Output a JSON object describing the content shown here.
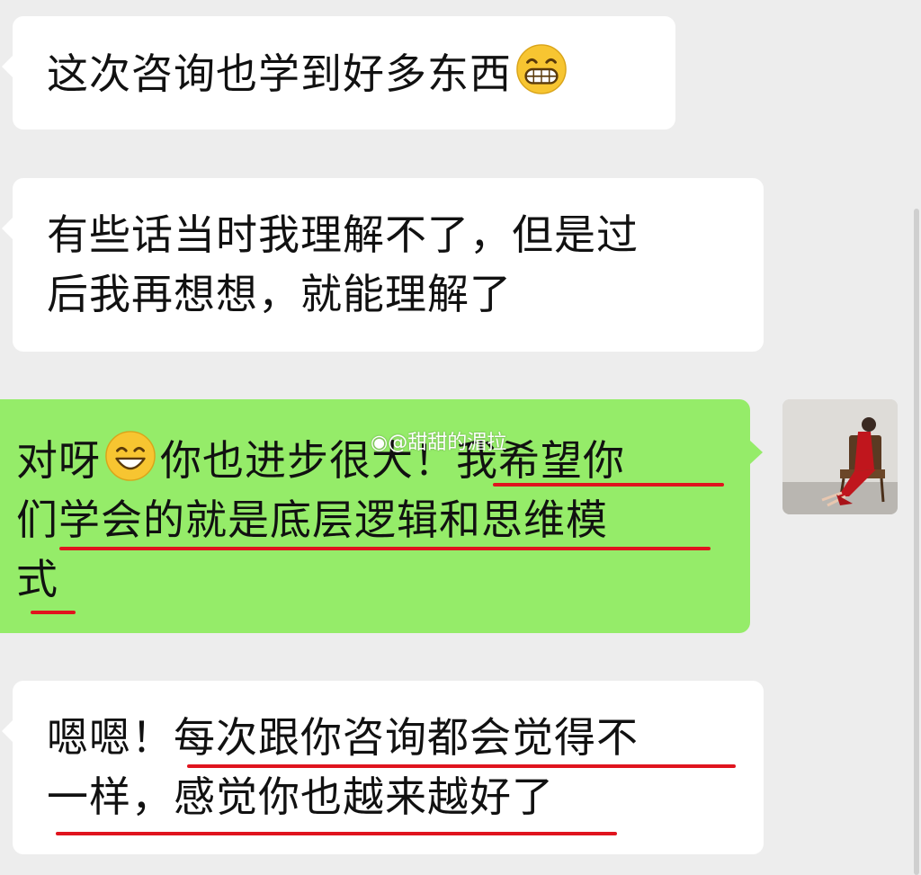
{
  "messages": [
    {
      "side": "left",
      "text": "这次咨询也学到好多东西",
      "emoji": "grinning-face-emoji"
    },
    {
      "side": "left",
      "line1": "有些话当时我理解不了，但是过",
      "line2": "后我再想想，就能理解了"
    },
    {
      "side": "right",
      "pre": "对呀",
      "emoji": "smiling-face-emoji",
      "line1_post": "你也进步很大！我希望你",
      "line2": "们学会的就是底层逻辑和思维模",
      "line3": "式"
    },
    {
      "side": "left",
      "line1": "嗯嗯！每次跟你咨询都会觉得不",
      "line2": "一样，感觉你也越来越好了"
    }
  ],
  "watermark": "@甜甜的湄拉",
  "colors": {
    "background": "#ededed",
    "incoming": "#ffffff",
    "outgoing": "#95ec69",
    "highlight": "#e0141e"
  }
}
